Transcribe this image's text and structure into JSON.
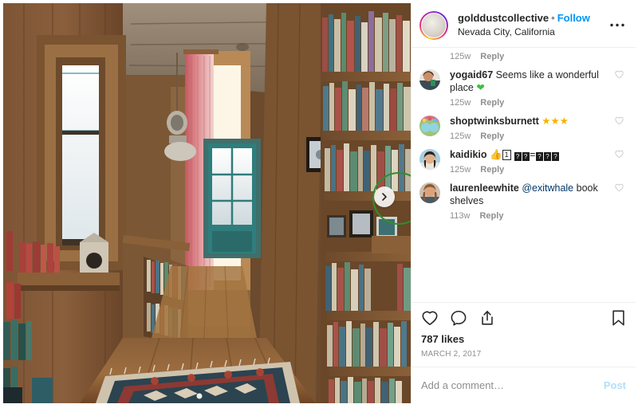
{
  "post": {
    "header": {
      "username": "golddustcollective",
      "separator": "•",
      "follow_label": "Follow",
      "location": "Nevada City, California",
      "more_icon": "more-horizontal-icon"
    },
    "media": {
      "alt": "Rustic wood-paneled cabin hallway with tall bookshelves, red curtain, teal door and patterned kilim rug",
      "carousel_next_icon": "chevron-right-icon",
      "annotation_color": "#2f8f2f"
    },
    "comments": [
      {
        "username": "",
        "text": "",
        "age": "125w",
        "reply_label": "Reply",
        "like_icon": "heart-outline-icon",
        "partial": true
      },
      {
        "username": "yogaid67",
        "text": "Seems like a wonderful place",
        "emoji": "💚",
        "age": "125w",
        "reply_label": "Reply",
        "like_icon": "heart-outline-icon"
      },
      {
        "username": "shoptwinksburnett",
        "text": "",
        "emoji": "⭐⭐⭐",
        "age": "125w",
        "reply_label": "Reply",
        "like_icon": "heart-outline-icon"
      },
      {
        "username": "kaidikio",
        "text": "",
        "emoji": "👍1️⃣ ??=???",
        "age": "125w",
        "reply_label": "Reply",
        "like_icon": "heart-outline-icon"
      },
      {
        "username": "laurenleewhite",
        "mention": "@exitwhale",
        "text": "book shelves",
        "age": "113w",
        "reply_label": "Reply",
        "like_icon": "heart-outline-icon"
      }
    ],
    "actions": {
      "like_icon": "heart-outline-icon",
      "comment_icon": "comment-bubble-icon",
      "share_icon": "share-upload-icon",
      "save_icon": "bookmark-outline-icon",
      "likes_count": "787 likes",
      "date": "MARCH 2, 2017"
    },
    "add_comment": {
      "placeholder": "Add a comment…",
      "value": "",
      "post_label": "Post"
    }
  }
}
